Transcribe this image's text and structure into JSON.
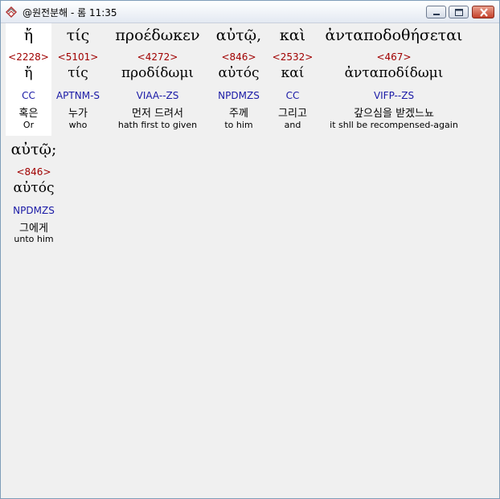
{
  "window": {
    "title": "@원전분해 - 롬 11:35",
    "icon": "book-icon",
    "buttons": {
      "minimize": "minimize-icon",
      "maximize": "maximize-icon",
      "close": "close-icon"
    }
  },
  "colors": {
    "strong": "#a00000",
    "morph": "#1a1aa6",
    "background": "#f0f0f0",
    "selected": "#ffffff"
  },
  "words": [
    {
      "greek": "ἤ",
      "strong": "<2228>",
      "lemma": "ἤ",
      "morph": "CC",
      "korean": "혹은",
      "english": "Or"
    },
    {
      "greek": "τίς",
      "strong": "<5101>",
      "lemma": "τίς",
      "morph": "APTNM-S",
      "korean": "누가",
      "english": "who"
    },
    {
      "greek": "προέδωκεν",
      "strong": "<4272>",
      "lemma": "προδίδωμι",
      "morph": "VIAA--ZS",
      "korean": "먼저 드려서",
      "english": "hath first to given"
    },
    {
      "greek": "αὐτῷ,",
      "strong": "<846>",
      "lemma": "αὐτός",
      "morph": "NPDMZS",
      "korean": "주께",
      "english": "to him"
    },
    {
      "greek": "καὶ",
      "strong": "<2532>",
      "lemma": "καί",
      "morph": "CC",
      "korean": "그리고",
      "english": "and"
    },
    {
      "greek": "ἀνταποδοθήσεται",
      "strong": "<467>",
      "lemma": "ἀνταποδίδωμι",
      "morph": "VIFP--ZS",
      "korean": "갚으심을 받겠느뇨",
      "english": "it shll be recompensed-again"
    },
    {
      "greek": "αὐτῷ;",
      "strong": "<846>",
      "lemma": "αὐτός",
      "morph": "NPDMZS",
      "korean": "그에게",
      "english": "unto him"
    }
  ]
}
